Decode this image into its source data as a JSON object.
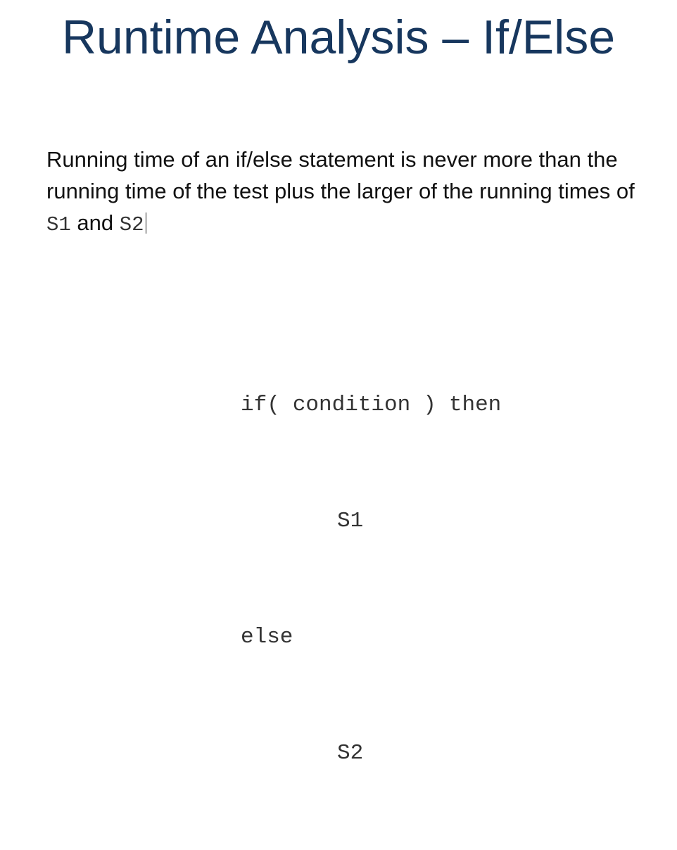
{
  "slide": {
    "title": "Runtime Analysis – If/Else",
    "text_before": "Running time of an if/else statement is never more than the running time of the test plus the larger of the running times of ",
    "code_s1": "S1",
    "text_and": " and ",
    "code_s2": "S2"
  },
  "code": {
    "line_if": "if(",
    "line_condition": "condition",
    "line_paren": ")",
    "line_then": "then",
    "line_s1": "S1",
    "line_else": "else",
    "line_s2": "S2"
  },
  "colors": {
    "title": "#17375e",
    "body": "#111111",
    "code": "#333333"
  }
}
